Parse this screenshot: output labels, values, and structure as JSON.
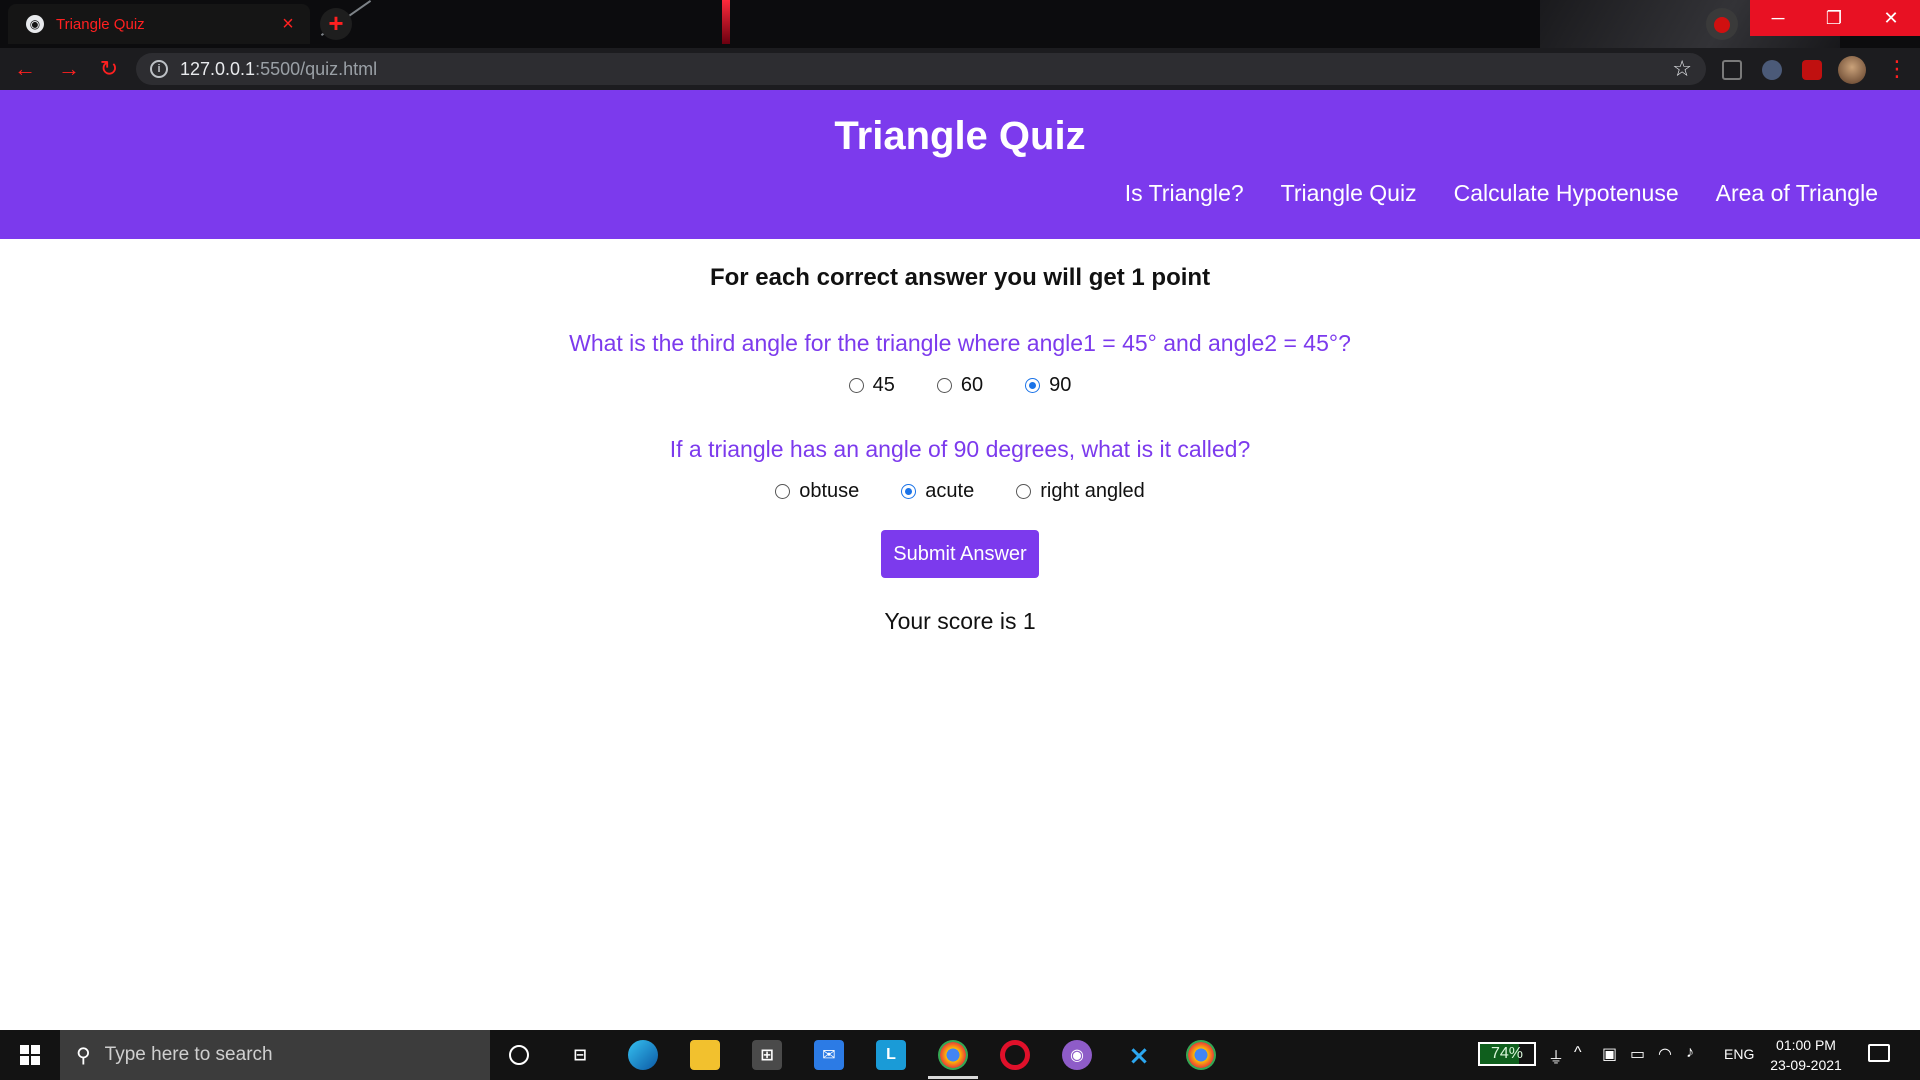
{
  "browser": {
    "tab_title": "Triangle Quiz",
    "url_host": "127.0.0.1",
    "url_path": ":5500/quiz.html"
  },
  "site": {
    "title": "Triangle Quiz",
    "nav": [
      "Is Triangle?",
      "Triangle Quiz",
      "Calculate Hypotenuse",
      "Area of Triangle"
    ]
  },
  "quiz": {
    "instructions": "For each correct answer you will get 1 point",
    "questions": [
      {
        "text": "What is the third angle for the triangle where angle1 = 45° and angle2 = 45°?",
        "options": [
          "45",
          "60",
          "90"
        ],
        "selected": "90"
      },
      {
        "text": "If a triangle has an angle of 90 degrees, what is it called?",
        "options": [
          "obtuse",
          "acute",
          "right angled"
        ],
        "selected": "acute"
      }
    ],
    "submit_label": "Submit Answer",
    "score_text": "Your score is 1"
  },
  "taskbar": {
    "search_placeholder": "Type here to search",
    "battery": "74%",
    "language": "ENG",
    "time": "01:00 PM",
    "date": "23-09-2021"
  },
  "colors": {
    "brand": "#7c3aed",
    "browser_accent": "#ff2020",
    "radio_checked": "#1a73e8"
  }
}
